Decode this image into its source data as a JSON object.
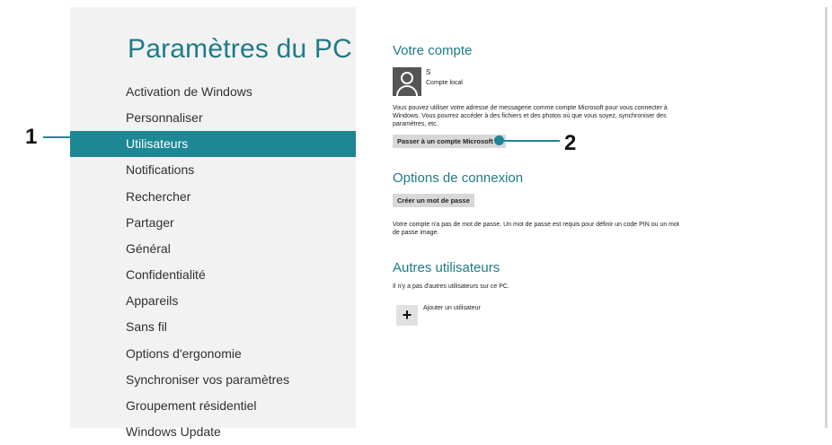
{
  "nav": {
    "title": "Paramètres du PC",
    "items": [
      {
        "label": "Activation de Windows"
      },
      {
        "label": "Personnaliser"
      },
      {
        "label": "Utilisateurs",
        "selected": true
      },
      {
        "label": "Notifications"
      },
      {
        "label": "Rechercher"
      },
      {
        "label": "Partager"
      },
      {
        "label": "Général"
      },
      {
        "label": "Confidentialité"
      },
      {
        "label": "Appareils"
      },
      {
        "label": "Sans fil"
      },
      {
        "label": "Options d'ergonomie"
      },
      {
        "label": "Synchroniser vos paramètres"
      },
      {
        "label": "Groupement résidentiel"
      },
      {
        "label": "Windows Update"
      }
    ]
  },
  "account": {
    "title": "Votre compte",
    "user_name": "S",
    "user_type": "Compte local",
    "description": "Vous pouvez utiliser votre adresse de messagerie comme compte Microsoft pour vous connecter à Windows. Vous pourrez accéder à des fichiers et des photos où que vous soyez, synchroniser des paramètres, etc.",
    "switch_button": "Passer à un compte Microsoft"
  },
  "signin": {
    "title": "Options de connexion",
    "create_password_button": "Créer un mot de passe",
    "note": "Votre compte n'a pas de mot de passe. Un mot de passe est requis pour définir un code PIN ou un mot de passe image."
  },
  "others": {
    "title": "Autres utilisateurs",
    "none_text": "Il n'y a pas d'autres utilisateurs sur ce PC.",
    "add_label": "Ajouter un utilisateur"
  },
  "callouts": {
    "one": "1",
    "two": "2"
  },
  "colors": {
    "accent": "#1e8795",
    "nav_bg": "#f2f2f2"
  }
}
